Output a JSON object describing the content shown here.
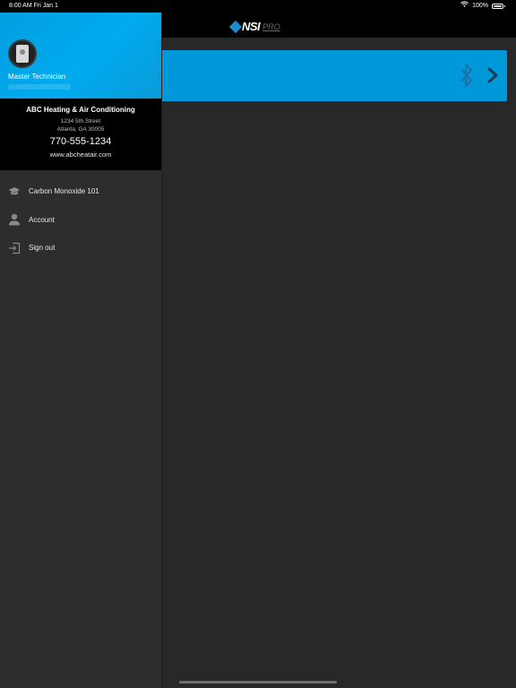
{
  "status_bar": {
    "time": "8:00 AM  Fri Jan 1",
    "battery": "100%"
  },
  "brand": {
    "name": "NSI",
    "sub": "PRO",
    "color": "#1a8fd0"
  },
  "drawer": {
    "role": "Master Technician",
    "company": {
      "name": "ABC Heating & Air Conditioning",
      "address_line1": "1234 5th Street",
      "address_line2": "Atlanta, GA 30005",
      "phone": "770-555-1234",
      "website": "www.abcheatair.com"
    },
    "menu": [
      {
        "label": "Carbon Monoxide 101",
        "icon": "graduation-cap-icon"
      },
      {
        "label": "Account",
        "icon": "person-icon"
      },
      {
        "label": "Sign out",
        "icon": "sign-out-icon"
      }
    ]
  },
  "device_card": {
    "accent": "#0098d8",
    "icons": [
      "bluetooth-icon",
      "chevron-right-icon"
    ]
  }
}
